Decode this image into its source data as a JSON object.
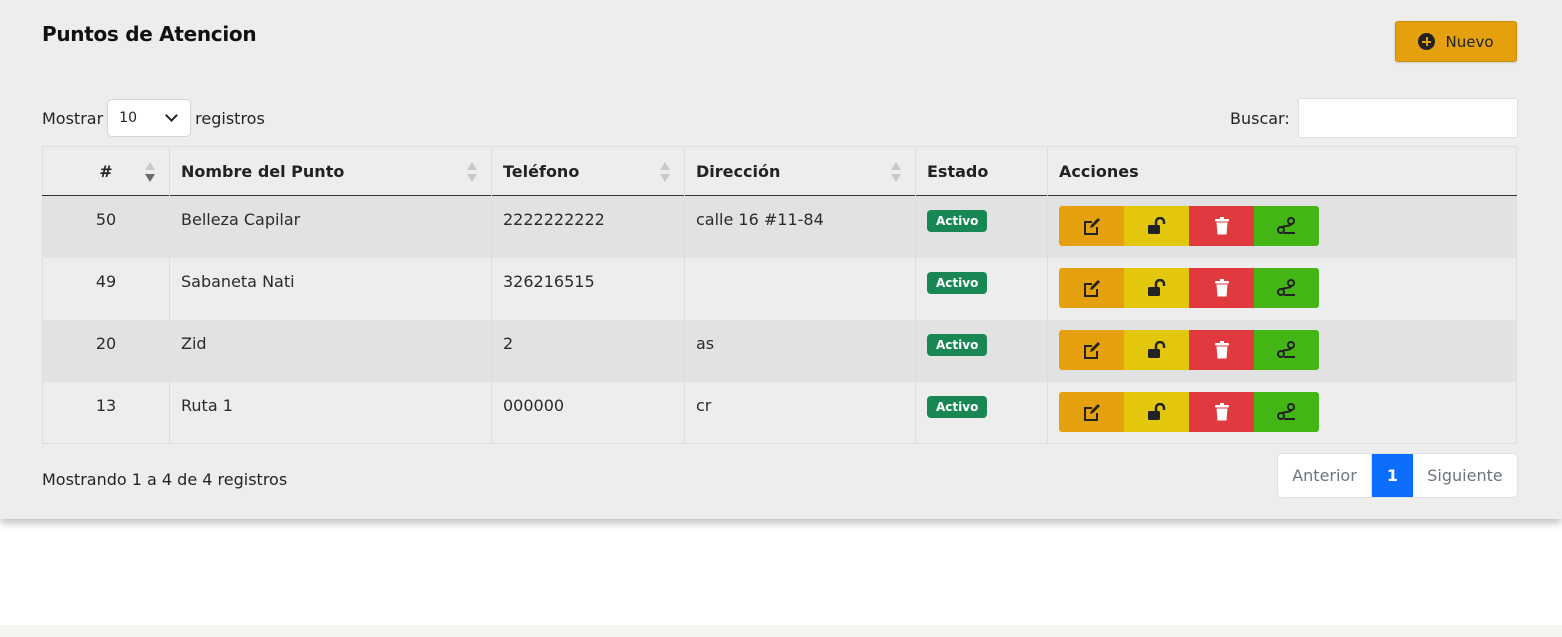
{
  "header": {
    "title": "Puntos de Atencion",
    "new_button_label": "Nuevo"
  },
  "length": {
    "prefix": "Mostrar",
    "selected": "10",
    "suffix": "registros"
  },
  "search": {
    "label": "Buscar:",
    "value": ""
  },
  "table": {
    "columns": [
      "#",
      "Nombre del Punto",
      "Teléfono",
      "Dirección",
      "Estado",
      "Acciones"
    ],
    "rows": [
      {
        "id": "50",
        "nombre": "Belleza Capilar",
        "telefono": "2222222222",
        "direccion": "calle 16 #11-84",
        "estado": "Activo"
      },
      {
        "id": "49",
        "nombre": "Sabaneta Nati",
        "telefono": "326216515",
        "direccion": "",
        "estado": "Activo"
      },
      {
        "id": "20",
        "nombre": "Zid",
        "telefono": "2",
        "direccion": "as",
        "estado": "Activo"
      },
      {
        "id": "13",
        "nombre": "Ruta 1",
        "telefono": "000000",
        "direccion": "cr",
        "estado": "Activo"
      }
    ],
    "action_icons": [
      "edit-icon",
      "unlock-icon",
      "trash-icon",
      "route-icon"
    ]
  },
  "footer": {
    "info": "Mostrando 1 a 4 de 4 registros",
    "prev_label": "Anterior",
    "current_page": "1",
    "next_label": "Siguiente"
  },
  "colors": {
    "accent": "#e5a00d",
    "warning": "#e2c70c",
    "danger": "#e0393e",
    "success": "#43b515",
    "badge": "#198754",
    "primary": "#0d6efd"
  }
}
